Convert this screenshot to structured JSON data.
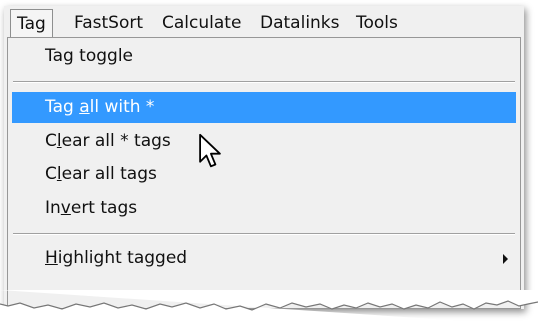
{
  "menubar": {
    "items": [
      {
        "label": "Tag"
      },
      {
        "label": "FastSort"
      },
      {
        "label": "Calculate"
      },
      {
        "label": "Datalinks"
      },
      {
        "label": "Tools"
      }
    ]
  },
  "menu": {
    "items": [
      {
        "pre": "Tag toggle",
        "mn": "",
        "post": ""
      },
      {
        "pre": "Tag ",
        "mn": "a",
        "post": "ll with *"
      },
      {
        "pre": "C",
        "mn": "l",
        "post": "ear all * tags"
      },
      {
        "pre": "C",
        "mn": "l",
        "post": "ear all tags"
      },
      {
        "pre": "In",
        "mn": "v",
        "post": "ert tags"
      },
      {
        "pre": "",
        "mn": "H",
        "post": "ighlight tagged"
      }
    ],
    "highlighted_index": 1,
    "highlight_color": "#3399ff"
  },
  "icons": {
    "cursor": "arrow-cursor-icon",
    "submenu": "submenu-arrow-icon"
  }
}
